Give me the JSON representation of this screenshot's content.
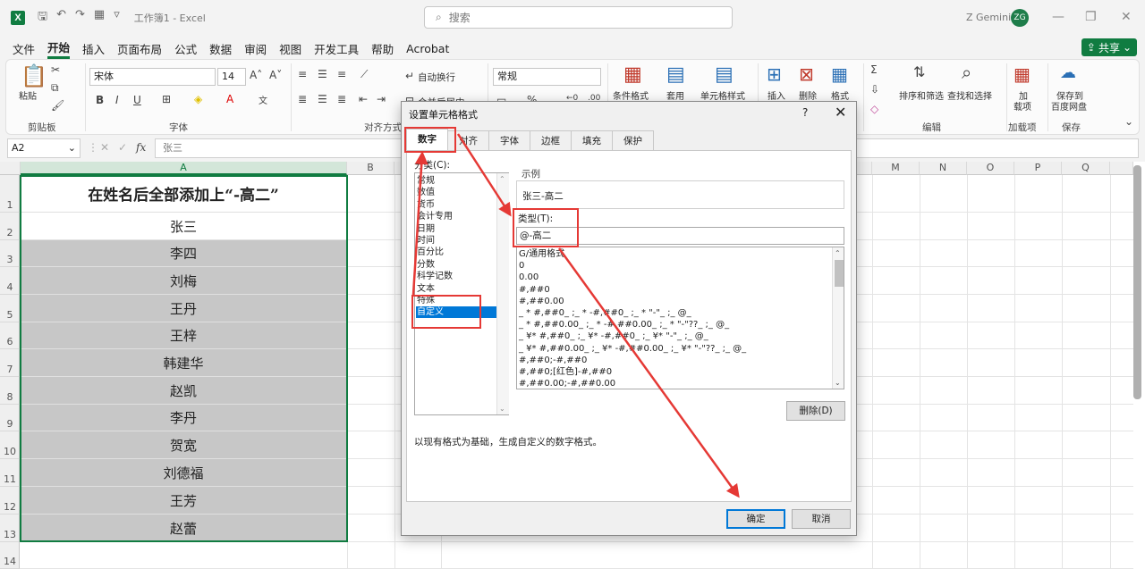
{
  "titlebar": {
    "doc_title": "工作簿1 - Excel",
    "search_placeholder": "搜索",
    "user_name": "Z Gemini",
    "avatar_initials": "ZG"
  },
  "menu": {
    "items": [
      "文件",
      "开始",
      "插入",
      "页面布局",
      "公式",
      "数据",
      "审阅",
      "视图",
      "开发工具",
      "帮助",
      "Acrobat"
    ],
    "share_label": "共享"
  },
  "ribbon": {
    "paste": "粘贴",
    "clipboard_group": "剪贴板",
    "font_name": "宋体",
    "font_size": "14",
    "font_group": "字体",
    "align_group": "对齐方式",
    "wrap_text": "自动换行",
    "merge_center": "合并后居中",
    "number_format": "常规",
    "conditional_format": "条件格式",
    "apply_table": "套用",
    "cell_style": "单元格样式",
    "insert": "插入",
    "delete": "删除",
    "format": "格式",
    "sort_filter": "排序和筛选",
    "find_select": "查找和选择",
    "edit_group": "编辑",
    "addins_line1": "加",
    "addins_line2": "载项",
    "addins_group": "加载项",
    "save_baidu_line1": "保存到",
    "save_baidu_line2": "百度网盘",
    "save_group": "保存"
  },
  "formula_bar": {
    "name_box": "A2",
    "fx": "fx",
    "content": "张三"
  },
  "sheet": {
    "columns_left": [
      "A",
      "B"
    ],
    "columns_right": [
      "M",
      "N",
      "O",
      "P",
      "Q"
    ],
    "rows": [
      "1",
      "2",
      "3",
      "4",
      "5",
      "6",
      "7",
      "8",
      "9",
      "10",
      "11",
      "12",
      "13",
      "14"
    ],
    "title": "在姓名后全部添加上“-高二”",
    "names": [
      "张三",
      "李四",
      "刘梅",
      "王丹",
      "王梓",
      "韩建华",
      "赵凯",
      "李丹",
      "贺宽",
      "刘德福",
      "王芳",
      "赵蕾"
    ]
  },
  "dialog": {
    "title": "设置单元格格式",
    "help": "?",
    "close": "✕",
    "tabs": [
      "数字",
      "对齐",
      "字体",
      "边框",
      "填充",
      "保护"
    ],
    "category_label": "分类(C):",
    "categories": [
      "常规",
      "数值",
      "货币",
      "会计专用",
      "日期",
      "时间",
      "百分比",
      "分数",
      "科学记数",
      "文本",
      "特殊",
      "自定义"
    ],
    "selected_category": "自定义",
    "sample_label": "示例",
    "sample_value": "张三-高二",
    "type_label": "类型(T):",
    "type_value": "@-高二",
    "format_list": [
      "G/通用格式",
      "0",
      "0.00",
      "#,##0",
      "#,##0.00",
      "_ * #,##0_ ;_ * -#,##0_ ;_ * \"-\"_ ;_ @_",
      "_ * #,##0.00_ ;_ * -#,##0.00_ ;_ * \"-\"??_ ;_ @_",
      "_ ¥* #,##0_ ;_ ¥* -#,##0_ ;_ ¥* \"-\"_ ;_ @_",
      "_ ¥* #,##0.00_ ;_ ¥* -#,##0.00_ ;_ ¥* \"-\"??_ ;_ @_",
      "#,##0;-#,##0",
      "#,##0;[红色]-#,##0",
      "#,##0.00;-#,##0.00"
    ],
    "delete_button": "删除(D)",
    "description": "以现有格式为基础，生成自定义的数字格式。",
    "ok_button": "确定",
    "cancel_button": "取消"
  },
  "colors": {
    "excel_green": "#107c41",
    "highlight_red": "#e53935",
    "selected_blue": "#0078d7",
    "cell_gray": "#c7c7c7"
  }
}
